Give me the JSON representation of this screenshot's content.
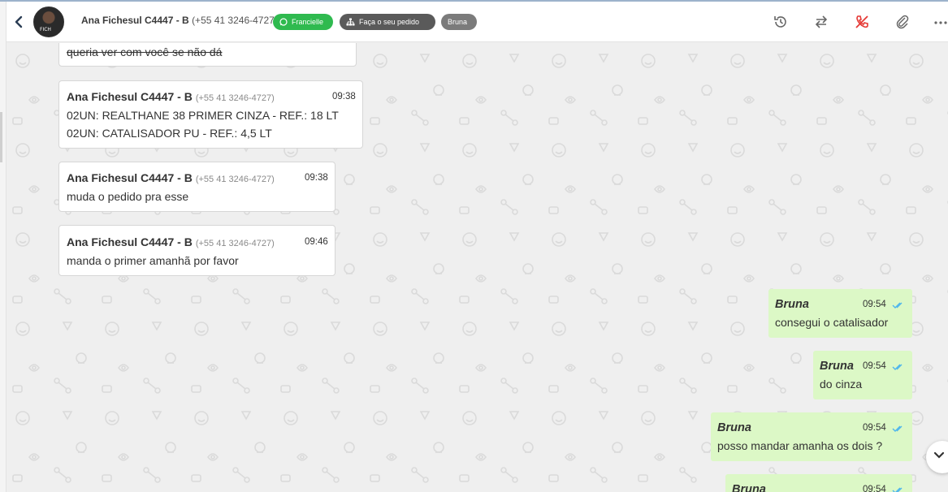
{
  "header": {
    "contact_name": "Ana Fichesul C4447 - B",
    "contact_phone": "(+55 41 3246-4727)",
    "tags": {
      "whatsapp": "Francielle",
      "order": "Faça o seu pedido",
      "agent": "Bruna"
    },
    "colors": {
      "whatsapp_tag": "#2fba4f",
      "order_tag": "#5a5a5a",
      "agent_tag": "#7b7b7b"
    }
  },
  "messages": {
    "m0": {
      "line1": "queria ver com você se não dá"
    },
    "m1": {
      "sender": "Ana Fichesul C4447 - B",
      "phone": "(+55 41 3246-4727)",
      "time": "09:38",
      "line1": "02UN: REALTHANE 38 PRIMER CINZA - REF.: 18 LT",
      "line2": "02UN: CATALISADOR PU - REF.: 4,5 LT"
    },
    "m2": {
      "sender": "Ana Fichesul C4447 - B",
      "phone": "(+55 41 3246-4727)",
      "time": "09:38",
      "line1": "muda o pedido pra esse"
    },
    "m3": {
      "sender": "Ana Fichesul C4447 - B",
      "phone": "(+55 41 3246-4727)",
      "time": "09:46",
      "line1": "manda o primer amanhã por favor"
    },
    "o1": {
      "sender": "Bruna",
      "time": "09:54",
      "line1": "consegui o catalisador"
    },
    "o2": {
      "sender": "Bruna",
      "time": "09:54",
      "line1": "do cinza"
    },
    "o3": {
      "sender": "Bruna",
      "time": "09:54",
      "line1": "posso mandar amanha os dois ?"
    },
    "o4": {
      "sender": "Bruna",
      "time": "09:54"
    }
  },
  "icons": [
    "back-icon",
    "history-icon",
    "transfer-icon",
    "end-call-icon",
    "attachment-icon",
    "more-icon",
    "chevron-down-icon",
    "double-check-icon"
  ],
  "colors": {
    "outgoing_bubble": "#dcf8c6",
    "read_ticks": "#4fb6ec",
    "end_call": "#e53935"
  }
}
